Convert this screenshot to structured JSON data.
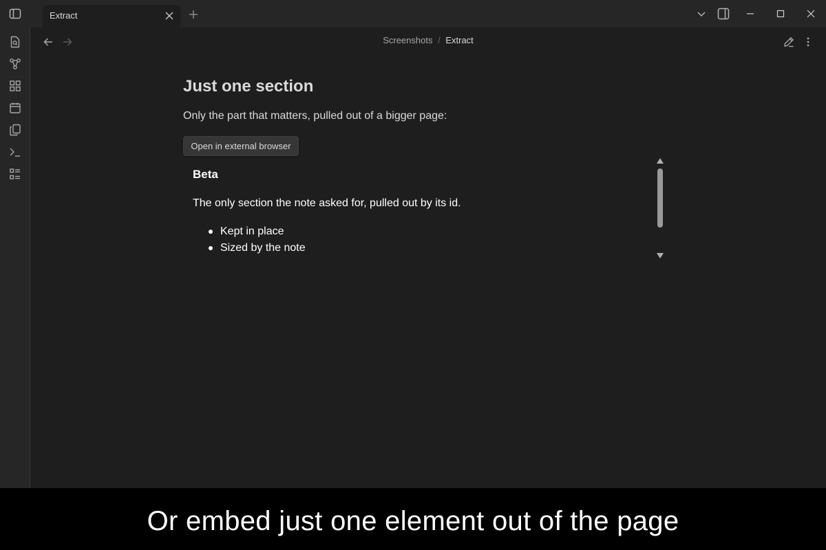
{
  "window": {
    "tab_title": "Extract"
  },
  "breadcrumb": {
    "folder": "Screenshots",
    "separator": "/",
    "current": "Extract"
  },
  "note": {
    "title": "Just one section",
    "intro": "Only the part that matters, pulled out of a bigger page:",
    "button_label": "Open in external browser"
  },
  "embed": {
    "heading": "Beta",
    "paragraph": "The only section the note asked for, pulled out by its id.",
    "list": [
      "Kept in place",
      "Sized by the note"
    ]
  },
  "caption": "Or embed just one element out of the page",
  "icons": {
    "sidebar_toggle": "sidebar-icon",
    "tab_close": "close-icon",
    "new_tab": "plus-icon",
    "tab_list": "chevron-down-icon",
    "right_sidebar": "sidebar-right-icon",
    "minimize": "minimize-icon",
    "maximize": "maximize-icon",
    "close_window": "close-icon",
    "ribbon": [
      "file-search-icon",
      "graph-icon",
      "blocks-icon",
      "calendar-icon",
      "copy-icon",
      "terminal-icon",
      "list-icon"
    ],
    "back": "arrow-left-icon",
    "forward": "arrow-right-icon",
    "edit": "pencil-icon",
    "more": "more-vertical-icon"
  },
  "colors": {
    "background": "#1e1e1e",
    "chrome": "#262626",
    "text": "#dadada",
    "caption_bg": "#000000"
  }
}
